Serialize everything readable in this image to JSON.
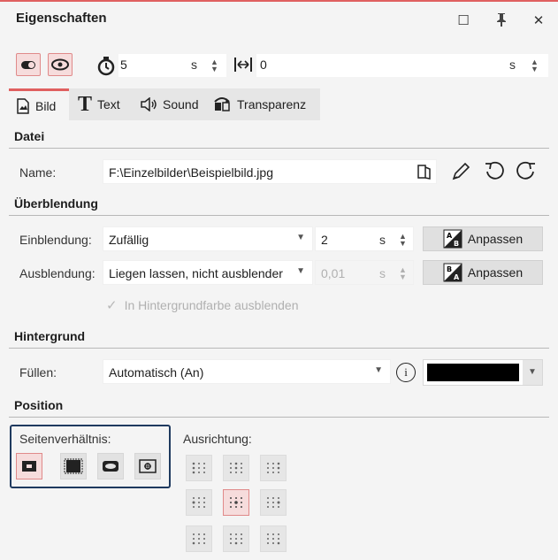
{
  "panel": {
    "title": "Eigenschaften",
    "window_buttons": [
      "maximize-icon",
      "pin-icon",
      "close-icon"
    ],
    "close_glyph": "✕",
    "maximize_glyph": "☐",
    "pin_glyph": "₮"
  },
  "toolbar": {
    "duration_value": "5",
    "duration_unit": "s",
    "offset_value": "0",
    "offset_unit": "s"
  },
  "tabs": [
    {
      "label": "Bild",
      "icon": "image-icon",
      "active": true
    },
    {
      "label": "Text",
      "icon": "text-icon",
      "active": false
    },
    {
      "label": "Sound",
      "icon": "speaker-icon",
      "active": false
    },
    {
      "label": "Transparenz",
      "icon": "transparency-icon",
      "active": false
    }
  ],
  "datei": {
    "heading": "Datei",
    "name_label": "Name:",
    "name_value": "F:\\Einzelbilder\\Beispielbild.jpg"
  },
  "ueberblendung": {
    "heading": "Überblendung",
    "ein_label": "Einblendung:",
    "ein_value": "Zufällig",
    "ein_duration": "2",
    "ein_unit": "s",
    "ein_button": "Anpassen",
    "aus_label": "Ausblendung:",
    "aus_value": "Liegen lassen, nicht ausblender",
    "aus_duration": "0,01",
    "aus_unit": "s",
    "aus_button": "Anpassen",
    "checkbox_label": "In Hintergrundfarbe ausblenden",
    "checkbox_checked": true
  },
  "hintergrund": {
    "heading": "Hintergrund",
    "fill_label": "Füllen:",
    "fill_value": "Automatisch (An)",
    "info_glyph": "i",
    "color": "#000000"
  },
  "position": {
    "heading": "Position",
    "aspect_label": "Seitenverhältnis:",
    "align_label": "Ausrichtung:",
    "selected_aspect": 0,
    "selected_alignment": 4
  },
  "colors": {
    "accent_red": "#e06060",
    "highlight_border": "#1f3a5f"
  }
}
